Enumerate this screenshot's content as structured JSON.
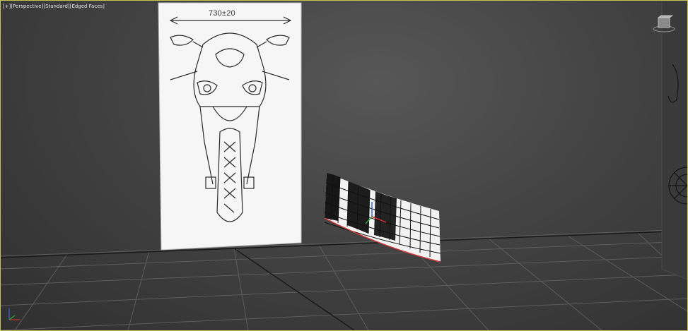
{
  "viewport": {
    "label_parts": [
      "[+]",
      "[Perspective]",
      "[Standard]",
      "[Edged Faces]"
    ]
  },
  "reference_image": {
    "dimension_label": "730±20"
  },
  "icons": [
    "viewcube-icon",
    "world-axis-icon",
    "transform-gizmo-icon"
  ],
  "colors": {
    "active_border": "#c9c25a",
    "grid": "#5e5e5e",
    "mesh_wire": "#ffffff",
    "selection_edge": "#d43a3a"
  }
}
